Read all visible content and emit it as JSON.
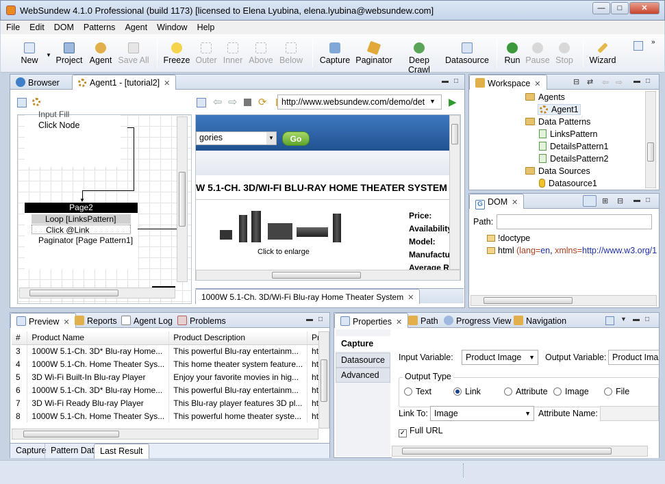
{
  "window": {
    "title": "WebSundew 4.1.0 Professional (build 1173) [licensed to Elena Lyubina, elena.lyubina@websundew.com]"
  },
  "menu": [
    "File",
    "Edit",
    "DOM",
    "Patterns",
    "Agent",
    "Window",
    "Help"
  ],
  "toolbar": {
    "new": "New",
    "project": "Project",
    "agent": "Agent",
    "save_all": "Save All",
    "freeze": "Freeze",
    "outer": "Outer",
    "inner": "Inner",
    "above": "Above",
    "below": "Below",
    "capture": "Capture",
    "paginator": "Paginator",
    "deep_crawl": "Deep Crawl",
    "datasource": "Datasource",
    "run": "Run",
    "pause": "Pause",
    "stop": "Stop",
    "wizard": "Wizard"
  },
  "editor": {
    "tabs": {
      "browser": "Browser",
      "agent": "Agent1 - [tutorial2]"
    },
    "url": "http://www.websundew.com/demo/det",
    "flow": {
      "input_fill": "Input Fill",
      "click_node": "Click Node",
      "page2": "Page2",
      "loop": "Loop [LinksPattern]",
      "click_link": "Click @Link",
      "paginator": "Paginator [Page Pattern1]"
    },
    "web": {
      "categories": "gories",
      "go": "Go",
      "heading": "W 5.1-CH. 3D/WI-FI BLU-RAY HOME THEATER SYSTEM",
      "enlarge": "Click to enlarge",
      "specs": [
        "Price:",
        "Availability",
        "Model:",
        "Manufactu",
        "Average Ra"
      ],
      "page_tab": "1000W 5.1-Ch. 3D/Wi-Fi Blu-ray Home Theater System"
    }
  },
  "workspace": {
    "tab": "Workspace",
    "tree": [
      {
        "label": "Agents",
        "icon": "folder-icon"
      },
      {
        "label": "Agent1",
        "icon": "gear-icon"
      },
      {
        "label": "Data Patterns",
        "icon": "folder-icon"
      },
      {
        "label": "LinksPattern",
        "icon": "pattern-icon"
      },
      {
        "label": "DetailsPattern1",
        "icon": "pattern-icon"
      },
      {
        "label": "DetailsPattern2",
        "icon": "pattern-icon"
      },
      {
        "label": "Data Sources",
        "icon": "folder-icon"
      },
      {
        "label": "Datasource1",
        "icon": "database-icon"
      }
    ]
  },
  "dom": {
    "tab": "DOM",
    "path_label": "Path:",
    "nodes": {
      "doctype": "!doctype",
      "html": "html",
      "open": "(",
      "lang_attr": "lang=",
      "lang_val": "en",
      "xmlns_attr": "xmlns=",
      "xmlns_val": "http://www.w3.org/1"
    }
  },
  "preview": {
    "tabs": [
      "Preview",
      "Reports",
      "Agent Log",
      "Problems"
    ],
    "columns": [
      "#",
      "Product Name",
      "Product Description",
      "Pr"
    ],
    "rows": [
      [
        "3",
        "1000W 5.1-Ch. 3D* Blu-ray Home...",
        "This powerful Blu-ray entertainm...",
        "ht"
      ],
      [
        "4",
        "1000W 5.1-Ch. Home Theater Sys...",
        "This home theater system feature...",
        "ht"
      ],
      [
        "5",
        "3D Wi-Fi Built-In Blu-ray  Player",
        "Enjoy your favorite movies in hig...",
        "ht"
      ],
      [
        "6",
        "1000W 5.1-Ch. 3D* Blu-ray Home...",
        "This powerful Blu-ray entertainm...",
        "ht"
      ],
      [
        "7",
        "3D Wi-Fi Ready Blu-ray Player",
        "This Blu-ray player features 3D pl...",
        "ht"
      ],
      [
        "8",
        "1000W 5.1-Ch. Home Theater Sys...",
        "This powerful home theater syste...",
        "ht"
      ]
    ],
    "bottom_tabs": [
      "Capture",
      "Pattern Data",
      "Last Result"
    ]
  },
  "properties": {
    "tabs": [
      "Properties",
      "Path",
      "Progress View",
      "Navigation"
    ],
    "side_tabs": [
      "Capture",
      "Datasource",
      "Advanced"
    ],
    "input_variable_label": "Input Variable:",
    "input_variable_value": "Product Image",
    "output_variable_label": "Output Variable:",
    "output_variable_value": "Product Ima",
    "output_type_label": "Output Type",
    "output_types": [
      "Text",
      "Link",
      "Attribute",
      "Image",
      "File"
    ],
    "selected_output_type": "Link",
    "link_to_label": "Link To:",
    "link_to_value": "Image",
    "attribute_name_label": "Attribute Name:",
    "full_url_label": "Full URL",
    "full_url_checked": true
  },
  "colors": {
    "accent": "#2f6bb3",
    "go_button": "#7cbf3a",
    "selection": "#d5e3f4"
  }
}
